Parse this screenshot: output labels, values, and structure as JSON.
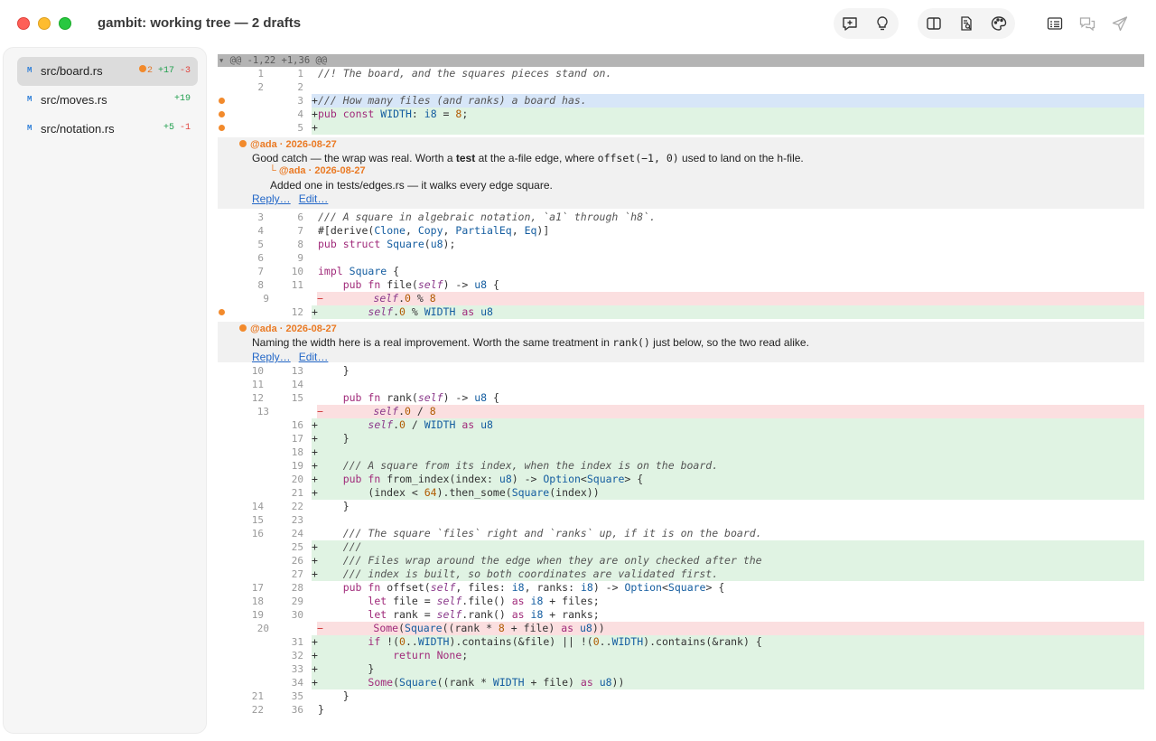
{
  "window": {
    "title": "gambit: working tree — 2 drafts"
  },
  "toolbar": {
    "groups": [
      [
        "add-comment-icon",
        "lightbulb-icon"
      ],
      [
        "split-view-icon",
        "review-doc-icon",
        "palette-icon"
      ],
      [
        "list-icon",
        "chat-bubbles-icon",
        "send-icon"
      ]
    ]
  },
  "sidebar": {
    "files": [
      {
        "status": "M",
        "name": "src/board.rs",
        "comments": "2",
        "added": "+17",
        "removed": "-3",
        "selected": true
      },
      {
        "status": "M",
        "name": "src/moves.rs",
        "comments": "",
        "added": "+19",
        "removed": "",
        "selected": false
      },
      {
        "status": "M",
        "name": "src/notation.rs",
        "comments": "",
        "added": "+5",
        "removed": "-1",
        "selected": false
      }
    ]
  },
  "diff": {
    "hunk_header": "▾ @@ -1,22 +1,36 @@",
    "comments": [
      {
        "author": "@ada",
        "date": "2026-08-27",
        "body_before": "Good catch — the wrap was real. Worth a ",
        "body_bold": "test",
        "body_mid": " at the a-file edge, where ",
        "body_code": "offset(−1, 0)",
        "body_after": " used to land on the h-file.",
        "reply_author": "@ada",
        "reply_date": "2026-08-27",
        "reply_body": "Added one in tests/edges.rs — it walks every edge square.",
        "reply_label": "Reply…",
        "edit_label": "Edit…"
      },
      {
        "author": "@ada",
        "date": "2026-08-27",
        "body_before": "Naming the width here is a real improvement. Worth the same treatment in ",
        "body_code": "rank()",
        "body_after": " just below, so the two read alike.",
        "reply_label": "Reply…",
        "edit_label": "Edit…"
      }
    ],
    "lines": [
      {
        "type": "ctx",
        "old": "1",
        "new": "1",
        "text": "//! The board, and the squares pieces stand on."
      },
      {
        "type": "ctx",
        "old": "2",
        "new": "2",
        "text": ""
      },
      {
        "type": "sel",
        "old": "",
        "new": "3",
        "text": "/// How many files (and ranks) a board has.",
        "dot": true
      },
      {
        "type": "add",
        "old": "",
        "new": "4",
        "text": "pub const WIDTH: i8 = 8;",
        "dot": true
      },
      {
        "type": "add",
        "old": "",
        "new": "5",
        "text": "",
        "dot": true
      },
      {
        "type": "ctx",
        "old": "3",
        "new": "6",
        "text": "/// A square in algebraic notation, `a1` through `h8`."
      },
      {
        "type": "ctx",
        "old": "4",
        "new": "7",
        "text": "#[derive(Clone, Copy, PartialEq, Eq)]"
      },
      {
        "type": "ctx",
        "old": "5",
        "new": "8",
        "text": "pub struct Square(u8);"
      },
      {
        "type": "ctx",
        "old": "6",
        "new": "9",
        "text": ""
      },
      {
        "type": "ctx",
        "old": "7",
        "new": "10",
        "text": "impl Square {"
      },
      {
        "type": "ctx",
        "old": "8",
        "new": "11",
        "text": "    pub fn file(self) -> u8 {"
      },
      {
        "type": "del",
        "old": "9",
        "new": "",
        "text": "        self.0 % 8"
      },
      {
        "type": "add",
        "old": "",
        "new": "12",
        "text": "        self.0 % WIDTH as u8",
        "dot": true
      },
      {
        "type": "ctx",
        "old": "10",
        "new": "13",
        "text": "    }"
      },
      {
        "type": "ctx",
        "old": "11",
        "new": "14",
        "text": ""
      },
      {
        "type": "ctx",
        "old": "12",
        "new": "15",
        "text": "    pub fn rank(self) -> u8 {"
      },
      {
        "type": "del",
        "old": "13",
        "new": "",
        "text": "        self.0 / 8"
      },
      {
        "type": "add",
        "old": "",
        "new": "16",
        "text": "        self.0 / WIDTH as u8"
      },
      {
        "type": "add",
        "old": "",
        "new": "17",
        "text": "    }"
      },
      {
        "type": "add",
        "old": "",
        "new": "18",
        "text": ""
      },
      {
        "type": "add",
        "old": "",
        "new": "19",
        "text": "    /// A square from its index, when the index is on the board."
      },
      {
        "type": "add",
        "old": "",
        "new": "20",
        "text": "    pub fn from_index(index: u8) -> Option<Square> {"
      },
      {
        "type": "add",
        "old": "",
        "new": "21",
        "text": "        (index < 64).then_some(Square(index))"
      },
      {
        "type": "ctx",
        "old": "14",
        "new": "22",
        "text": "    }"
      },
      {
        "type": "ctx",
        "old": "15",
        "new": "23",
        "text": ""
      },
      {
        "type": "ctx",
        "old": "16",
        "new": "24",
        "text": "    /// The square `files` right and `ranks` up, if it is on the board."
      },
      {
        "type": "add",
        "old": "",
        "new": "25",
        "text": "    ///"
      },
      {
        "type": "add",
        "old": "",
        "new": "26",
        "text": "    /// Files wrap around the edge when they are only checked after the"
      },
      {
        "type": "add",
        "old": "",
        "new": "27",
        "text": "    /// index is built, so both coordinates are validated first."
      },
      {
        "type": "ctx",
        "old": "17",
        "new": "28",
        "text": "    pub fn offset(self, files: i8, ranks: i8) -> Option<Square> {"
      },
      {
        "type": "ctx",
        "old": "18",
        "new": "29",
        "text": "        let file = self.file() as i8 + files;"
      },
      {
        "type": "ctx",
        "old": "19",
        "new": "30",
        "text": "        let rank = self.rank() as i8 + ranks;"
      },
      {
        "type": "del",
        "old": "20",
        "new": "",
        "text": "        Some(Square((rank * 8 + file) as u8))"
      },
      {
        "type": "add",
        "old": "",
        "new": "31",
        "text": "        if !(0..WIDTH).contains(&file) || !(0..WIDTH).contains(&rank) {"
      },
      {
        "type": "add",
        "old": "",
        "new": "32",
        "text": "            return None;"
      },
      {
        "type": "add",
        "old": "",
        "new": "33",
        "text": "        }"
      },
      {
        "type": "add",
        "old": "",
        "new": "34",
        "text": "        Some(Square((rank * WIDTH + file) as u8))"
      },
      {
        "type": "ctx",
        "old": "21",
        "new": "35",
        "text": "    }"
      },
      {
        "type": "ctx",
        "old": "22",
        "new": "36",
        "text": "}"
      }
    ]
  },
  "colors": {
    "added_bg": "#e0f3e3",
    "deleted_bg": "#fbdfe0",
    "selected_bg": "#d7e6f8",
    "comment_accent": "#f28a2c",
    "link": "#2468c8"
  }
}
